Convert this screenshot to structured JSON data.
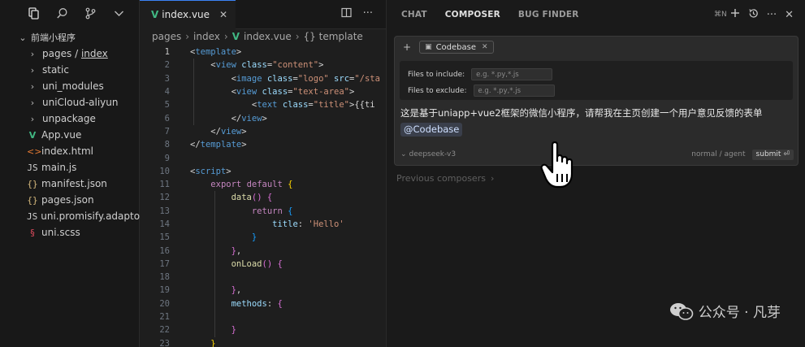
{
  "sidebar": {
    "toolbar_icons": [
      "files-icon",
      "search-icon",
      "source-control-icon",
      "chevron-down-icon"
    ],
    "root": "前端小程序",
    "folders": [
      "pages / index",
      "static",
      "uni_modules",
      "uniCloud-aliyun",
      "unpackage"
    ],
    "folder_pages": "pages",
    "folder_pages_sep": "/",
    "folder_pages_sub": "index",
    "files": [
      {
        "name": "App.vue",
        "icon": "vue-icon",
        "symbol": "V"
      },
      {
        "name": "index.html",
        "icon": "html-icon",
        "symbol": "<>"
      },
      {
        "name": "main.js",
        "icon": "js-icon",
        "symbol": "JS"
      },
      {
        "name": "manifest.json",
        "icon": "json-icon",
        "symbol": "{}"
      },
      {
        "name": "pages.json",
        "icon": "json-icon",
        "symbol": "{}"
      },
      {
        "name": "uni.promisify.adapto...",
        "icon": "js-icon",
        "symbol": "JS"
      },
      {
        "name": "uni.scss",
        "icon": "scss-icon",
        "symbol": "§"
      }
    ]
  },
  "editor": {
    "tab_label": "index.vue",
    "tab_close": "✕",
    "breadcrumb": [
      "pages",
      "index",
      "index.vue",
      "{} template"
    ],
    "line_numbers": [
      "1",
      "2",
      "3",
      "4",
      "5",
      "6",
      "7",
      "8",
      "9",
      "10",
      "11",
      "12",
      "13",
      "14",
      "15",
      "16",
      "17",
      "18",
      "19",
      "20",
      "21",
      "22",
      "23"
    ],
    "current_line": "1"
  },
  "panel": {
    "tabs": [
      "CHAT",
      "COMPOSER",
      "BUG FINDER"
    ],
    "active_tab": "COMPOSER",
    "shortcut": "⌘N",
    "context_pill": "Codebase",
    "files_include_label": "Files to include:",
    "files_include_placeholder": "e.g. *.py,*.js",
    "files_exclude_label": "Files to exclude:",
    "files_exclude_placeholder": "e.g. *.py,*.js",
    "prompt_text": "这是基于uniapp+vue2框架的微信小程序，请帮我在主页创建一个用户意见反馈的表单",
    "mention": "@Codebase",
    "model": "deepseek-v3",
    "mode": "normal / agent",
    "submit_label": "submit",
    "submit_key": "⏎",
    "previous_label": "Previous composers",
    "previous_chevron": "›"
  },
  "watermark": {
    "text": "公众号 · 凡芽"
  },
  "colors": {
    "background": "#1e1e1e",
    "sidebar_bg": "#181818",
    "panel_bg": "#1a1a1a",
    "composer_bg": "#2b2b2b",
    "vue_green": "#41b883",
    "accent_blue": "#3b82f6"
  }
}
